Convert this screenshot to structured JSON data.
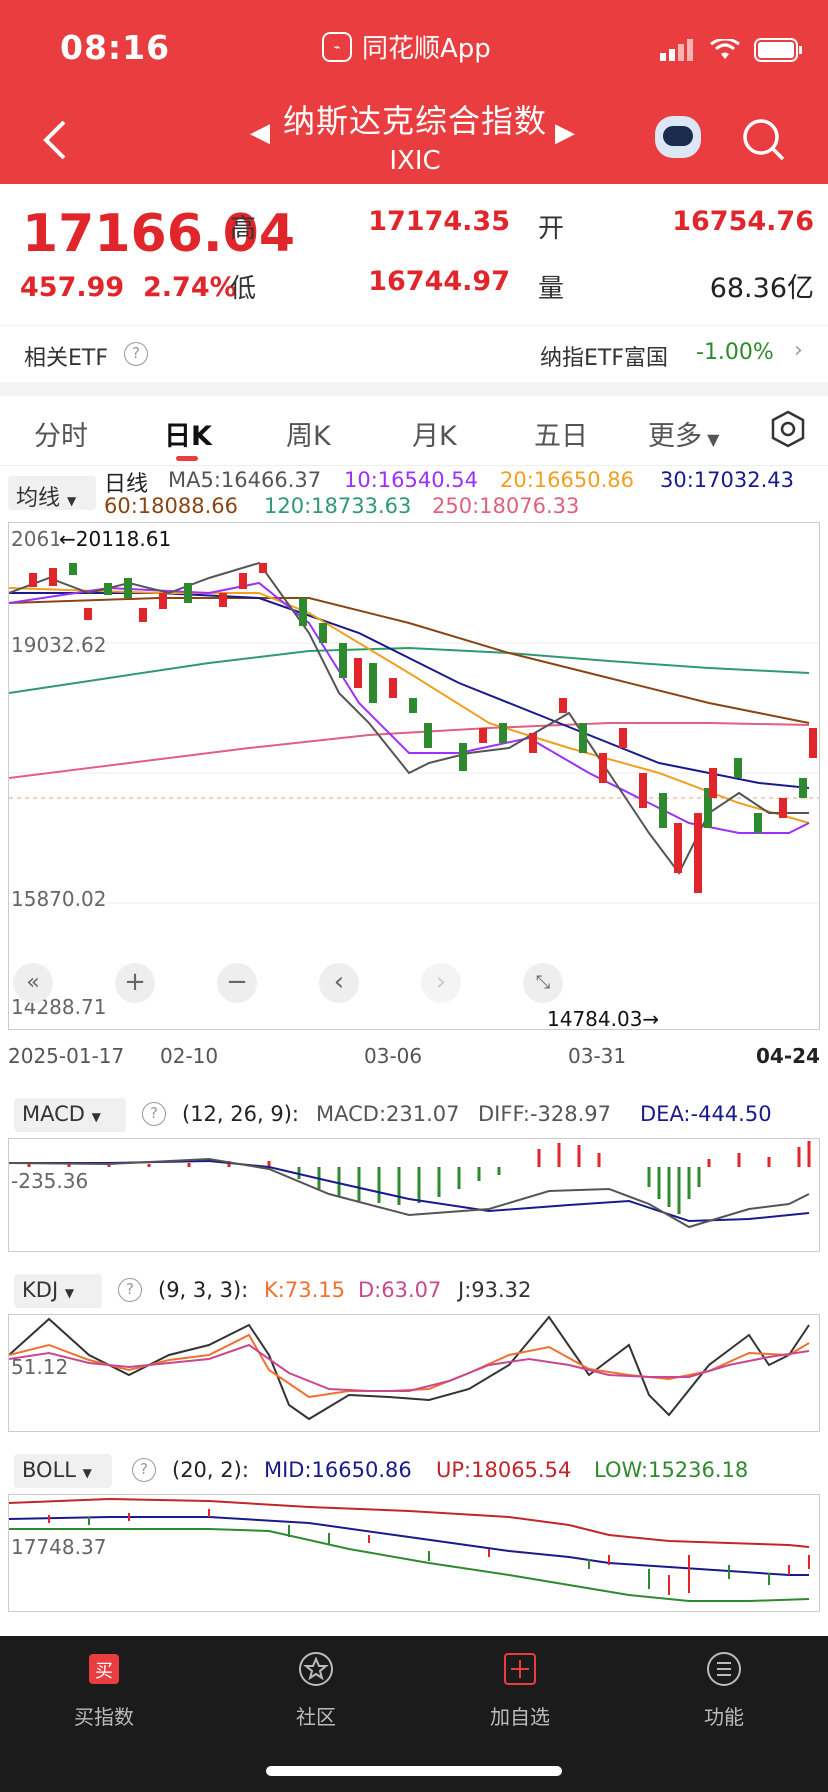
{
  "status": {
    "time": "08:16",
    "app_name": "同花顺App"
  },
  "header": {
    "title": "纳斯达克综合指数",
    "code": "IXIC"
  },
  "quote": {
    "price": "17166.04",
    "change": "457.99",
    "change_pct": "2.74%",
    "high_label": "高",
    "high": "17174.35",
    "low_label": "低",
    "low": "16744.97",
    "open_label": "开",
    "open": "16754.76",
    "volume_label": "量",
    "volume": "68.36亿"
  },
  "etf": {
    "label": "相关ETF",
    "fund": "纳指ETF富国",
    "fund_change": "-1.00%"
  },
  "tabs": [
    "分时",
    "日K",
    "周K",
    "月K",
    "五日",
    "更多"
  ],
  "ma": {
    "button": "均线",
    "line_label": "日线",
    "ma5": "MA5:16466.37",
    "ma10": "10:16540.54",
    "ma20": "20:16650.86",
    "ma30": "30:17032.43",
    "ma60": "60:18088.66",
    "ma120": "120:18733.63",
    "ma250": "250:18076.33"
  },
  "kline": {
    "y_top": "20618.28",
    "y_mid1": "19032.62",
    "y_mid2": "15870.02",
    "y_bot": "14288.71",
    "max_marker": "←20118.61",
    "min_marker": "14784.03→",
    "x_labels": [
      "2025-01-17",
      "02-10",
      "03-06",
      "03-31",
      "04-24"
    ]
  },
  "macd": {
    "button": "MACD",
    "params": "(12, 26, 9):",
    "macd": "MACD:231.07",
    "diff": "DIFF:-328.97",
    "dea": "DEA:-444.50",
    "axis": "-235.36"
  },
  "kdj": {
    "button": "KDJ",
    "params": "(9, 3, 3):",
    "k": "K:73.15",
    "d": "D:63.07",
    "j": "J:93.32",
    "axis": "51.12"
  },
  "boll": {
    "button": "BOLL",
    "params": "(20, 2):",
    "mid": "MID:16650.86",
    "up": "UP:18065.54",
    "low": "LOW:15236.18",
    "axis": "17748.37"
  },
  "nav": [
    {
      "label": "买指数",
      "icon": "buy-icon"
    },
    {
      "label": "社区",
      "icon": "community-icon"
    },
    {
      "label": "加自选",
      "icon": "add-watchlist-icon"
    },
    {
      "label": "功能",
      "icon": "menu-icon"
    }
  ],
  "colors": {
    "up": "#e0262a",
    "down": "#2f8a2f",
    "header": "#e93d3f",
    "ma5": "#555555",
    "ma10": "#9b30ff",
    "ma20": "#f0a020",
    "ma30": "#1a1a8c",
    "ma60": "#8b4513",
    "ma120": "#2e9a6e",
    "ma250": "#e06080"
  }
}
